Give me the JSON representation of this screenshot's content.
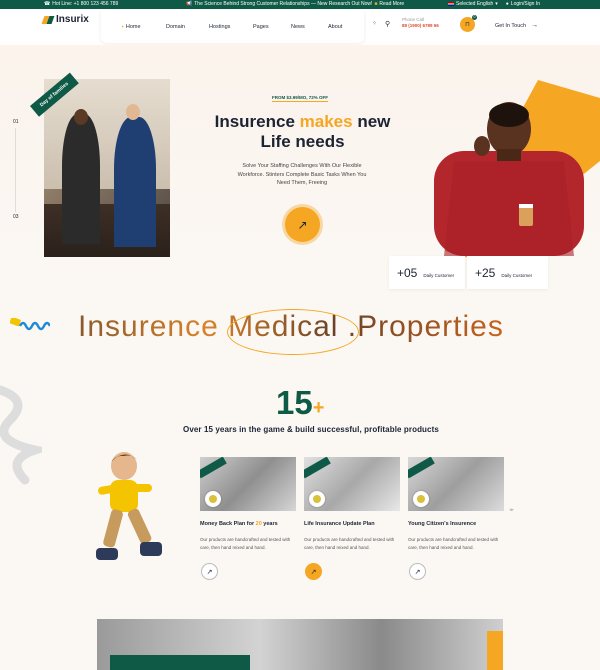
{
  "topbar": {
    "hotline": "Hot Line: +1 800 123 456 789",
    "news": "The Science Behind Strong Customer Relationships — New Research Out Now!",
    "read_more": "Read More",
    "language": "Selected English",
    "login": "Login/Sign In"
  },
  "header": {
    "logo": "Insurix",
    "nav": [
      {
        "label": "Home",
        "active": true
      },
      {
        "label": "Domain"
      },
      {
        "label": "Hostings"
      },
      {
        "label": "Pages"
      },
      {
        "label": "News"
      },
      {
        "label": "About"
      }
    ],
    "phone_label": "Phone Call",
    "phone_number": "88 (1900) 6789 56",
    "cart_count": "0",
    "cta": "Get In Touch"
  },
  "hero": {
    "slide_top": "01",
    "slide_bottom": "03",
    "ribbon": "Day of families",
    "price": "FROM $3.99/MO, 72% OFF",
    "title_pre": "Insurence ",
    "title_highlight": "makes",
    "title_post": " new",
    "title_line2": "Life needs",
    "description": "Solve Your Staffing Challenges With Our Flexible Workforce. Stinters Complete Basic Tasks When You Need Them, Freeing",
    "stats": [
      {
        "value": "+05",
        "label": "Daily Customer"
      },
      {
        "value": "+25",
        "label": "Daily Customer"
      }
    ]
  },
  "marquee": {
    "text": "Insurence Medical .Properties"
  },
  "experience": {
    "number": "15",
    "plus": "+",
    "caption": "Over 15 years in the game & build successful, profitable products"
  },
  "cards": [
    {
      "title_pre": "Money Back Plan for ",
      "title_highlight": "20",
      "title_post": " years",
      "desc": "Our products are handcrafted and tested with care, then hand mixed and hand."
    },
    {
      "title_pre": "Life Insurance Update Plan",
      "title_highlight": "",
      "title_post": "",
      "desc": "Our products are handcrafted and tested with care, then hand mixed and hand."
    },
    {
      "title_pre": "Young Citizen's Insurence",
      "title_highlight": "",
      "title_post": "",
      "desc": "Our products are handcrafted and tested with care, then hand mixed and hand."
    }
  ],
  "colors": {
    "brand_green": "#0f5a47",
    "accent_orange": "#f5a623",
    "text_dark": "#1c2333"
  }
}
